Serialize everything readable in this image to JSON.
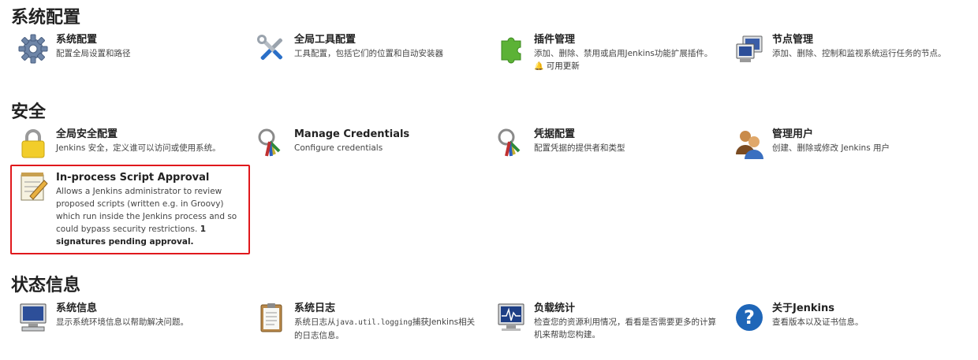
{
  "sections": {
    "system_config": {
      "title": "系统配置",
      "items": [
        {
          "title": "系统配置",
          "desc": "配置全局设置和路径",
          "icon": "gear-icon"
        },
        {
          "title": "全局工具配置",
          "desc": "工具配置，包括它们的位置和自动安装器",
          "icon": "tools-icon"
        },
        {
          "title": "插件管理",
          "desc": "添加、删除、禁用或启用Jenkins功能扩展插件。",
          "update": "可用更新",
          "icon": "puzzle-icon"
        },
        {
          "title": "节点管理",
          "desc": "添加、删除、控制和监视系统运行任务的节点。",
          "icon": "computer-icon"
        }
      ]
    },
    "security": {
      "title": "安全",
      "items": [
        {
          "title": "全局安全配置",
          "desc": "Jenkins 安全，定义谁可以访问或使用系统。",
          "icon": "lock-icon"
        },
        {
          "title": "Manage Credentials",
          "desc": "Configure credentials",
          "icon": "keys-icon"
        },
        {
          "title": "凭据配置",
          "desc": "配置凭据的提供者和类型",
          "icon": "keys-icon"
        },
        {
          "title": "管理用户",
          "desc": "创建、删除或修改 Jenkins 用户",
          "icon": "users-icon"
        }
      ],
      "approval": {
        "title": "In-process Script Approval",
        "desc": "Allows a Jenkins administrator to review proposed scripts (written e.g. in Groovy) which run inside the Jenkins process and so could bypass security restrictions.",
        "pending": "1 signatures pending approval.",
        "icon": "notepad-icon"
      }
    },
    "status": {
      "title": "状态信息",
      "items": [
        {
          "title": "系统信息",
          "desc": "显示系统环境信息以帮助解决问题。",
          "icon": "monitor-icon"
        },
        {
          "title": "系统日志",
          "desc_pre": "系统日志从",
          "desc_code": "java.util.logging",
          "desc_post": "捕获Jenkins相关的日志信息。",
          "icon": "clipboard-icon"
        },
        {
          "title": "负载统计",
          "desc": "检查您的资源利用情况，看看是否需要更多的计算机来帮助您构建。",
          "icon": "load-monitor-icon"
        },
        {
          "title": "关于Jenkins",
          "desc": "查看版本以及证书信息。",
          "icon": "help-icon"
        }
      ]
    }
  },
  "colors": {
    "highlight_border": "#e0181c",
    "bell": "#d01818"
  }
}
